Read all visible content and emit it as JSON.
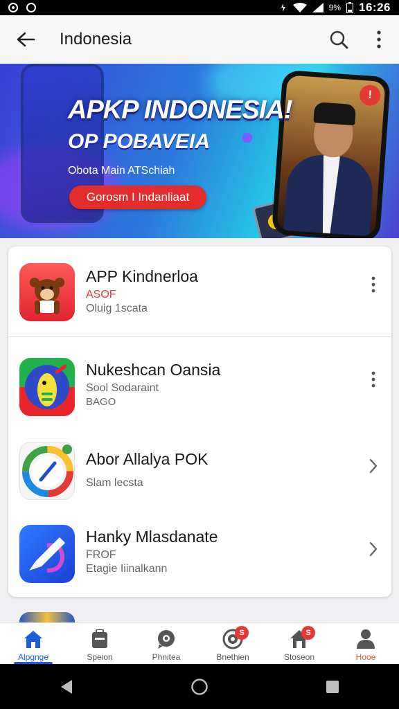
{
  "status_bar": {
    "left_icons": [
      "notification-icon",
      "app-circle-icon"
    ],
    "right_icons": [
      "vibrate-icon",
      "wifi-icon",
      "signal-icon",
      "battery-icon"
    ],
    "battery_percent": "9%",
    "time": "16:26"
  },
  "app_bar": {
    "title": "Indonesia",
    "back_icon": "arrow-back-icon",
    "search_icon": "search-icon",
    "more_icon": "more-vert-icon"
  },
  "banner": {
    "title": "APKP INDONESIA!",
    "subtitle": "OP POBAVEIA",
    "small_text": "Obota Main ATSchiah",
    "cta_label": "Gorosm I Indanliaat",
    "badge": "!"
  },
  "apps": [
    {
      "title": "APP Kindnerloa",
      "line1": "ASOF",
      "line2": "Oluig 1scata",
      "icon": "monkey-app-icon",
      "action": "more-vert-icon",
      "line1_red": true
    },
    {
      "title": "Nukeshcan Oansia",
      "line1": "Sool Sodaraint",
      "line2": "BAGO",
      "icon": "colorful-app-icon",
      "action": "more-vert-icon",
      "line1_red": false
    },
    {
      "title": "Abor Allalya POK",
      "line1": "",
      "line2": "Slam lecsta",
      "icon": "compass-app-icon",
      "action": "chevron-right-icon",
      "line1_red": false
    },
    {
      "title": "Hanky Mlasdanate",
      "line1": "FROF",
      "line2": "Etagie Iiinalkann",
      "icon": "pen-app-icon",
      "action": "chevron-right-icon",
      "line1_red": false
    }
  ],
  "bottom_nav": {
    "items": [
      {
        "label": "Alpgnge",
        "icon": "home-icon",
        "active": true,
        "badge": ""
      },
      {
        "label": "Speion",
        "icon": "briefcase-icon",
        "active": false,
        "badge": ""
      },
      {
        "label": "Phnitea",
        "icon": "chat-icon",
        "active": false,
        "badge": ""
      },
      {
        "label": "Bnethien",
        "icon": "target-icon",
        "active": false,
        "badge": "S"
      },
      {
        "label": "Stoseon",
        "icon": "store-icon",
        "active": false,
        "badge": "S"
      },
      {
        "label": "Hooe",
        "icon": "person-icon",
        "active": false,
        "badge": ""
      }
    ]
  },
  "system_nav": {
    "icons": [
      "back-triangle-icon",
      "home-circle-icon",
      "recents-square-icon"
    ]
  },
  "colors": {
    "accent": "#1f5bd8",
    "badge_red": "#e53935",
    "banner_cta": "#e32d2d"
  }
}
